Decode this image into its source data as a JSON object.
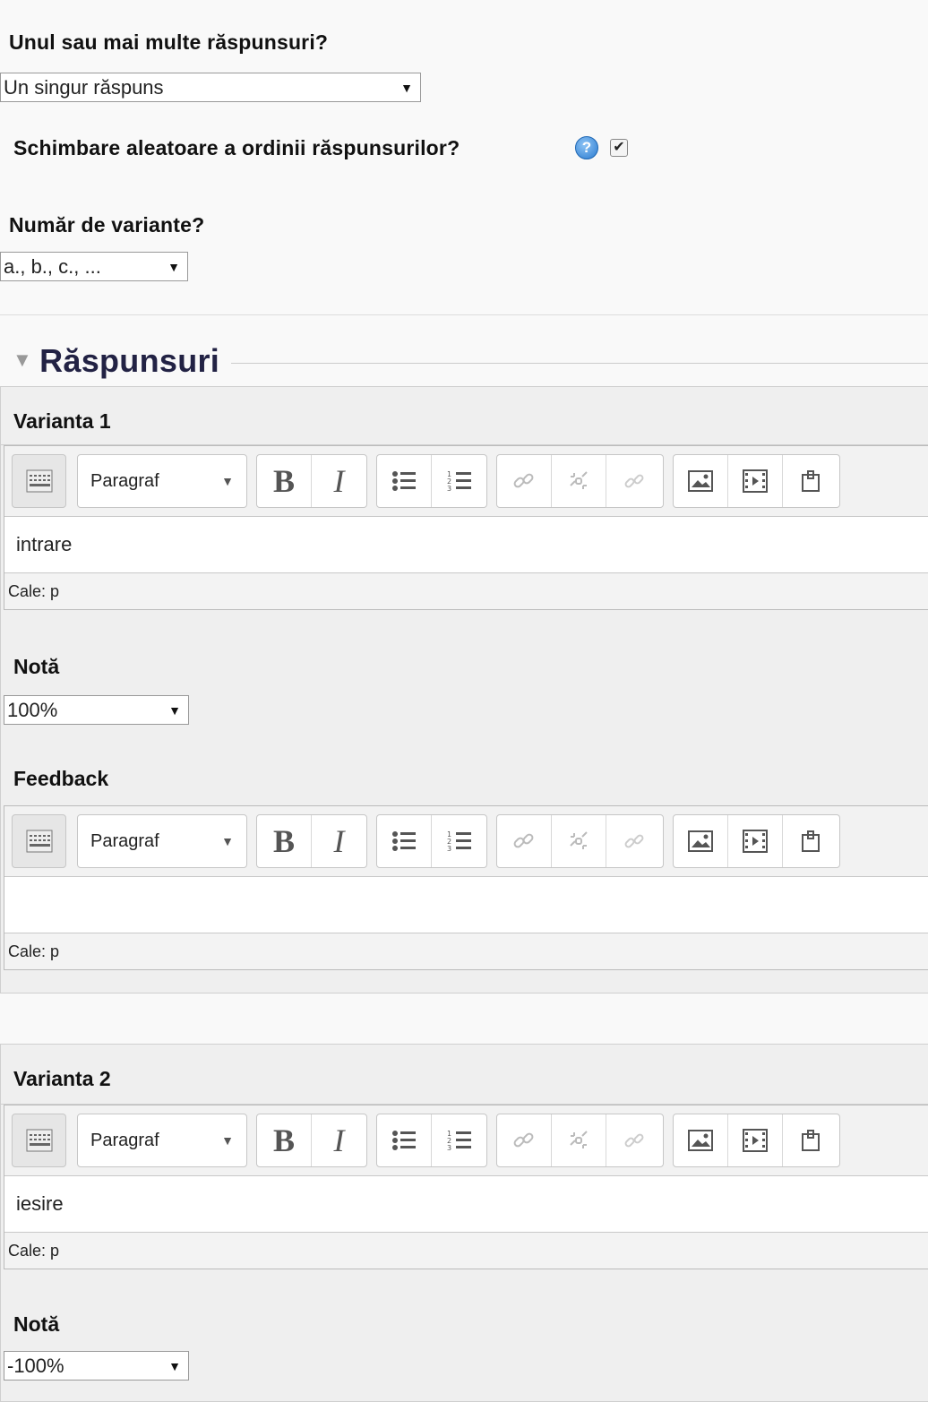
{
  "top": {
    "multi_label": "Unul sau mai multe răspunsuri?",
    "multi_value": "Un singur răspuns",
    "shuffle_label": "Schimbare aleatoare a ordinii răspunsurilor?",
    "shuffle_help": "?",
    "shuffle_checked": "✔",
    "numbering_label": "Număr de variante?",
    "numbering_value": "a., b., c., ..."
  },
  "section": {
    "title": "Răspunsuri",
    "collapse_icon": "triangle-down"
  },
  "editor": {
    "format_label": "Paragraf",
    "bold": "B",
    "italic": "I",
    "path_label": "Cale: p"
  },
  "answers": [
    {
      "title": "Varianta 1",
      "text": "intrare",
      "grade_label": "Notă",
      "grade_value": "100%",
      "feedback_label": "Feedback",
      "feedback_text": ""
    },
    {
      "title": "Varianta 2",
      "text": "iesire",
      "grade_label": "Notă",
      "grade_value": "-100%"
    }
  ]
}
